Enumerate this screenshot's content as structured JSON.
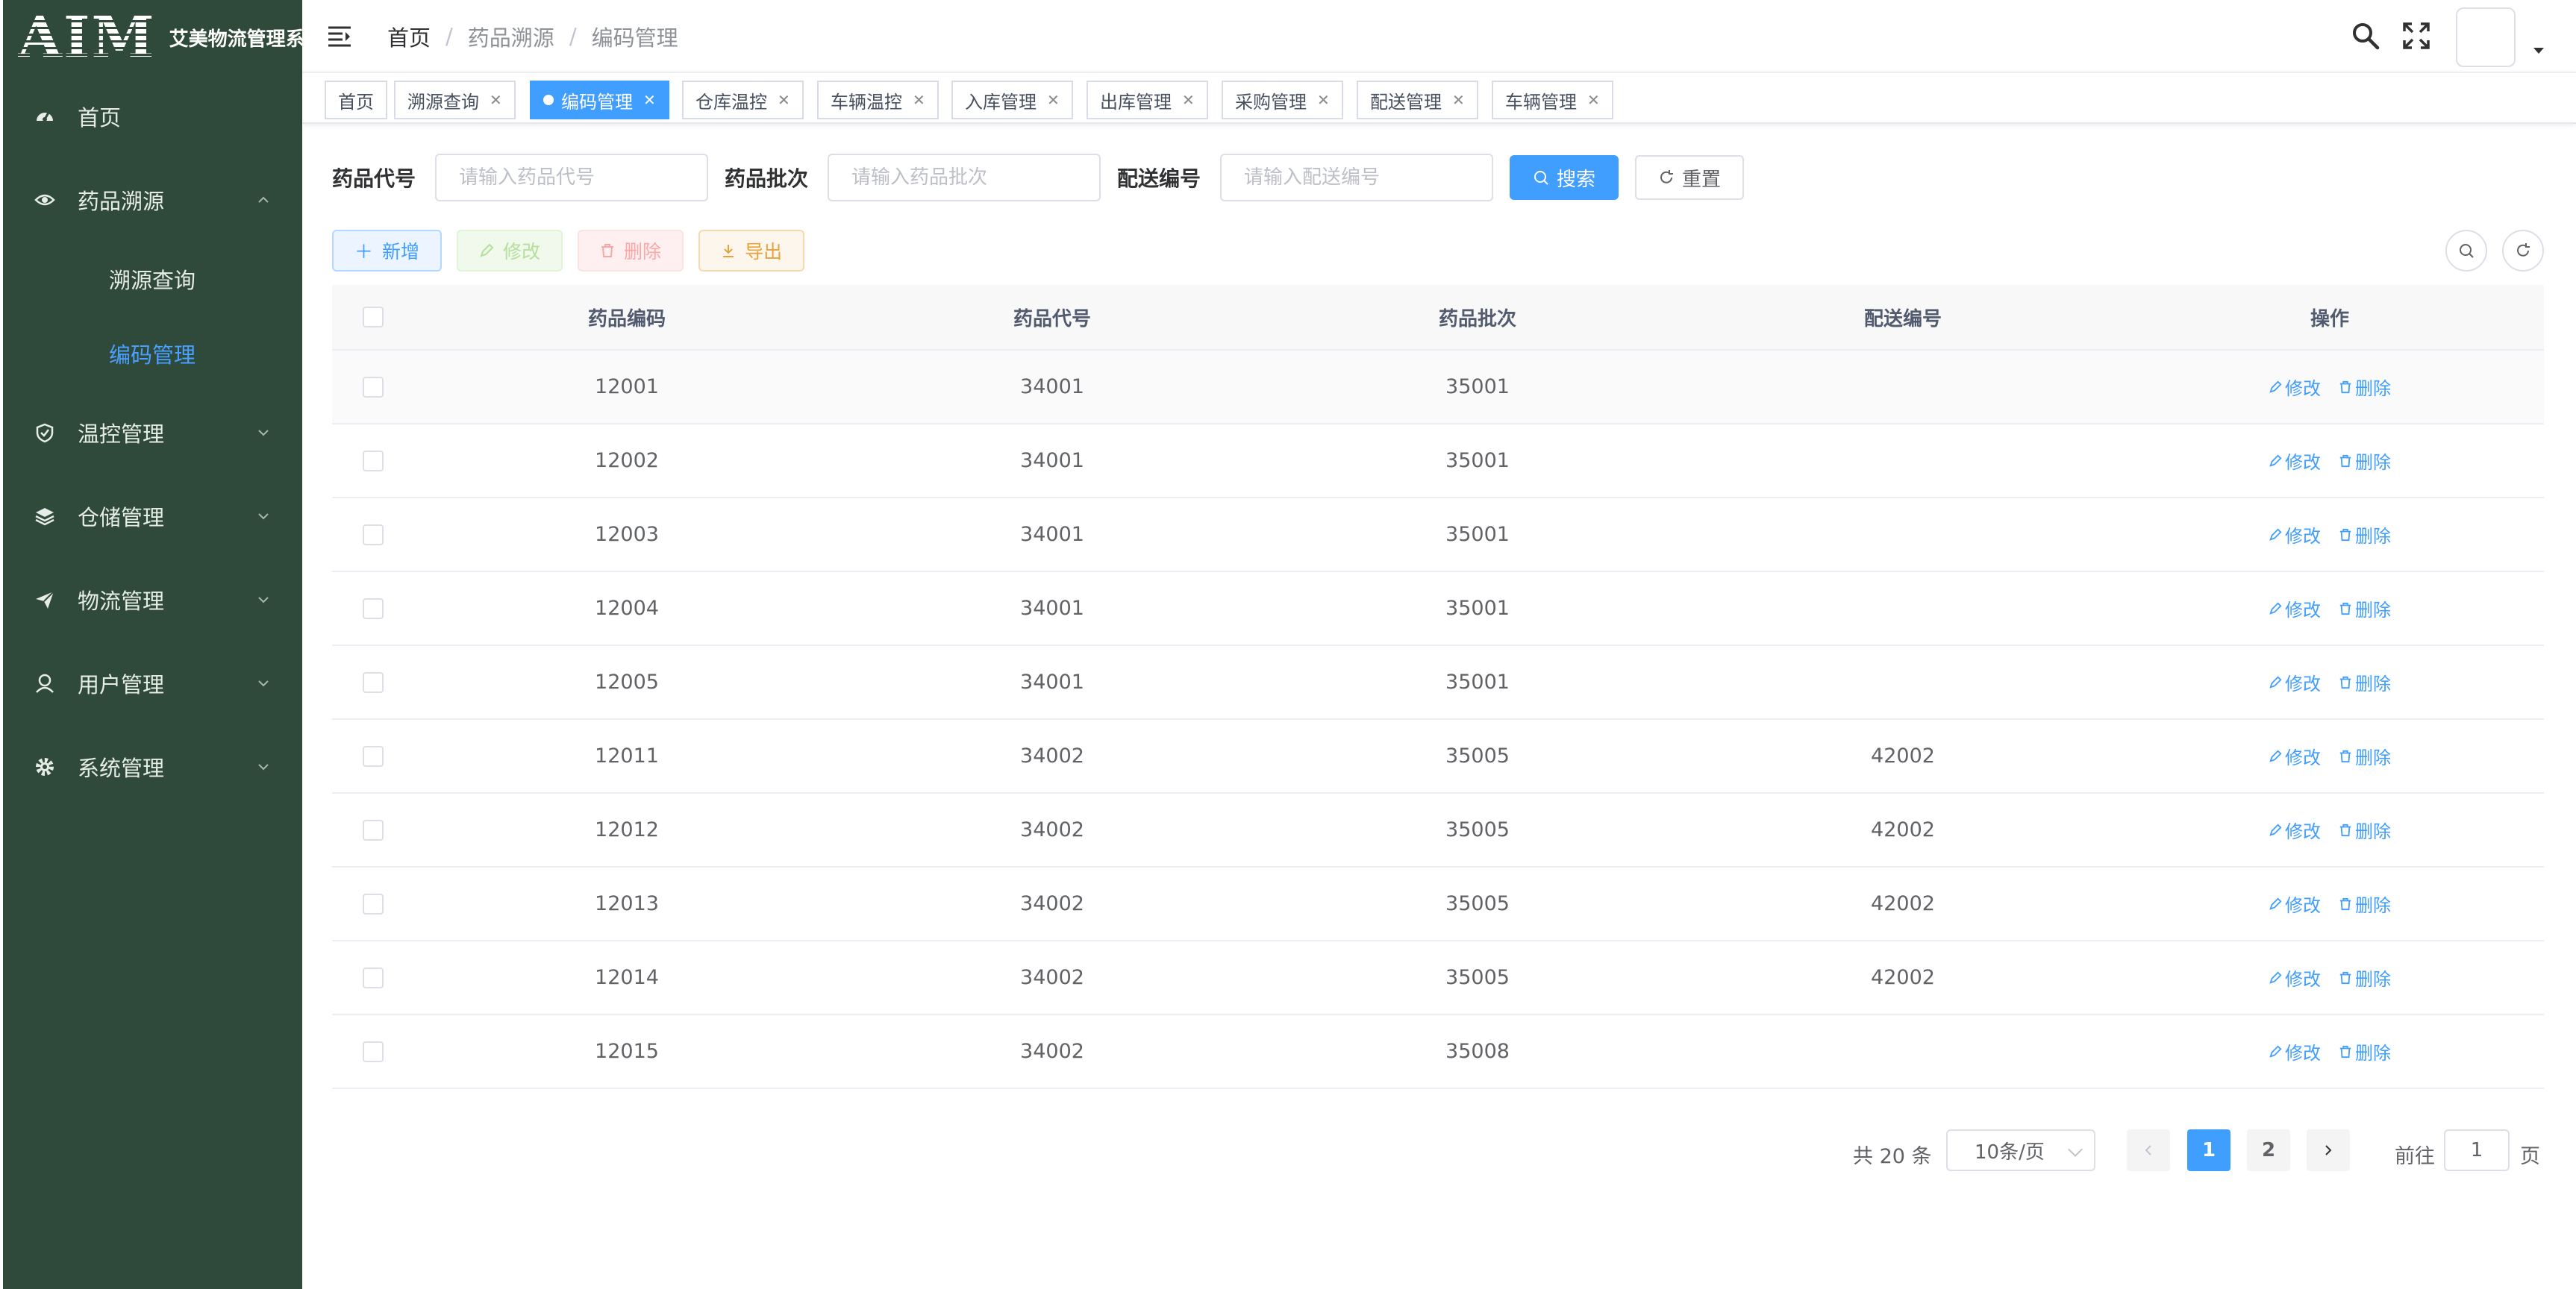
{
  "app": {
    "logo_mark": "AIM",
    "title": "艾美物流管理系统"
  },
  "sidebar": {
    "items": [
      {
        "label": "首页",
        "icon": "dashboard-icon"
      },
      {
        "label": "药品溯源",
        "icon": "eye-icon",
        "expanded": true,
        "children": [
          {
            "label": "溯源查询"
          },
          {
            "label": "编码管理",
            "active": true
          }
        ]
      },
      {
        "label": "温控管理",
        "icon": "shield-icon"
      },
      {
        "label": "仓储管理",
        "icon": "layers-icon"
      },
      {
        "label": "物流管理",
        "icon": "send-icon"
      },
      {
        "label": "用户管理",
        "icon": "user-icon"
      },
      {
        "label": "系统管理",
        "icon": "gear-icon"
      }
    ]
  },
  "breadcrumb": {
    "home": "首页",
    "sep": "/",
    "section": "药品溯源",
    "current": "编码管理"
  },
  "tags": [
    {
      "label": "首页",
      "closable": false
    },
    {
      "label": "溯源查询",
      "closable": true
    },
    {
      "label": "编码管理",
      "closable": true,
      "active": true
    },
    {
      "label": "仓库温控",
      "closable": true
    },
    {
      "label": "车辆温控",
      "closable": true
    },
    {
      "label": "入库管理",
      "closable": true
    },
    {
      "label": "出库管理",
      "closable": true
    },
    {
      "label": "采购管理",
      "closable": true
    },
    {
      "label": "配送管理",
      "closable": true
    },
    {
      "label": "车辆管理",
      "closable": true
    }
  ],
  "search": {
    "drug_code_label": "药品代号",
    "drug_code_placeholder": "请输入药品代号",
    "batch_label": "药品批次",
    "batch_placeholder": "请输入药品批次",
    "delivery_label": "配送编号",
    "delivery_placeholder": "请输入配送编号",
    "search_btn": "搜索",
    "reset_btn": "重置"
  },
  "toolbar": {
    "add": "新增",
    "edit": "修改",
    "delete": "删除",
    "export": "导出"
  },
  "table": {
    "columns": [
      "药品编码",
      "药品代号",
      "药品批次",
      "配送编号",
      "操作"
    ],
    "edit_label": "修改",
    "delete_label": "删除",
    "rows": [
      {
        "code": "12001",
        "drug": "34001",
        "batch": "35001",
        "delivery": ""
      },
      {
        "code": "12002",
        "drug": "34001",
        "batch": "35001",
        "delivery": ""
      },
      {
        "code": "12003",
        "drug": "34001",
        "batch": "35001",
        "delivery": ""
      },
      {
        "code": "12004",
        "drug": "34001",
        "batch": "35001",
        "delivery": ""
      },
      {
        "code": "12005",
        "drug": "34001",
        "batch": "35001",
        "delivery": ""
      },
      {
        "code": "12011",
        "drug": "34002",
        "batch": "35005",
        "delivery": "42002"
      },
      {
        "code": "12012",
        "drug": "34002",
        "batch": "35005",
        "delivery": "42002"
      },
      {
        "code": "12013",
        "drug": "34002",
        "batch": "35005",
        "delivery": "42002"
      },
      {
        "code": "12014",
        "drug": "34002",
        "batch": "35005",
        "delivery": "42002"
      },
      {
        "code": "12015",
        "drug": "34002",
        "batch": "35008",
        "delivery": ""
      }
    ]
  },
  "pagination": {
    "total_text": "共 20 条",
    "page_size": "10条/页",
    "pages": [
      "1",
      "2"
    ],
    "current_page": "1",
    "goto_label": "前往",
    "goto_value": "1",
    "page_suffix": "页"
  },
  "colors": {
    "sidebar_bg": "#2f4a3a",
    "primary": "#409eff",
    "active_menu": "#4aa0ff"
  }
}
